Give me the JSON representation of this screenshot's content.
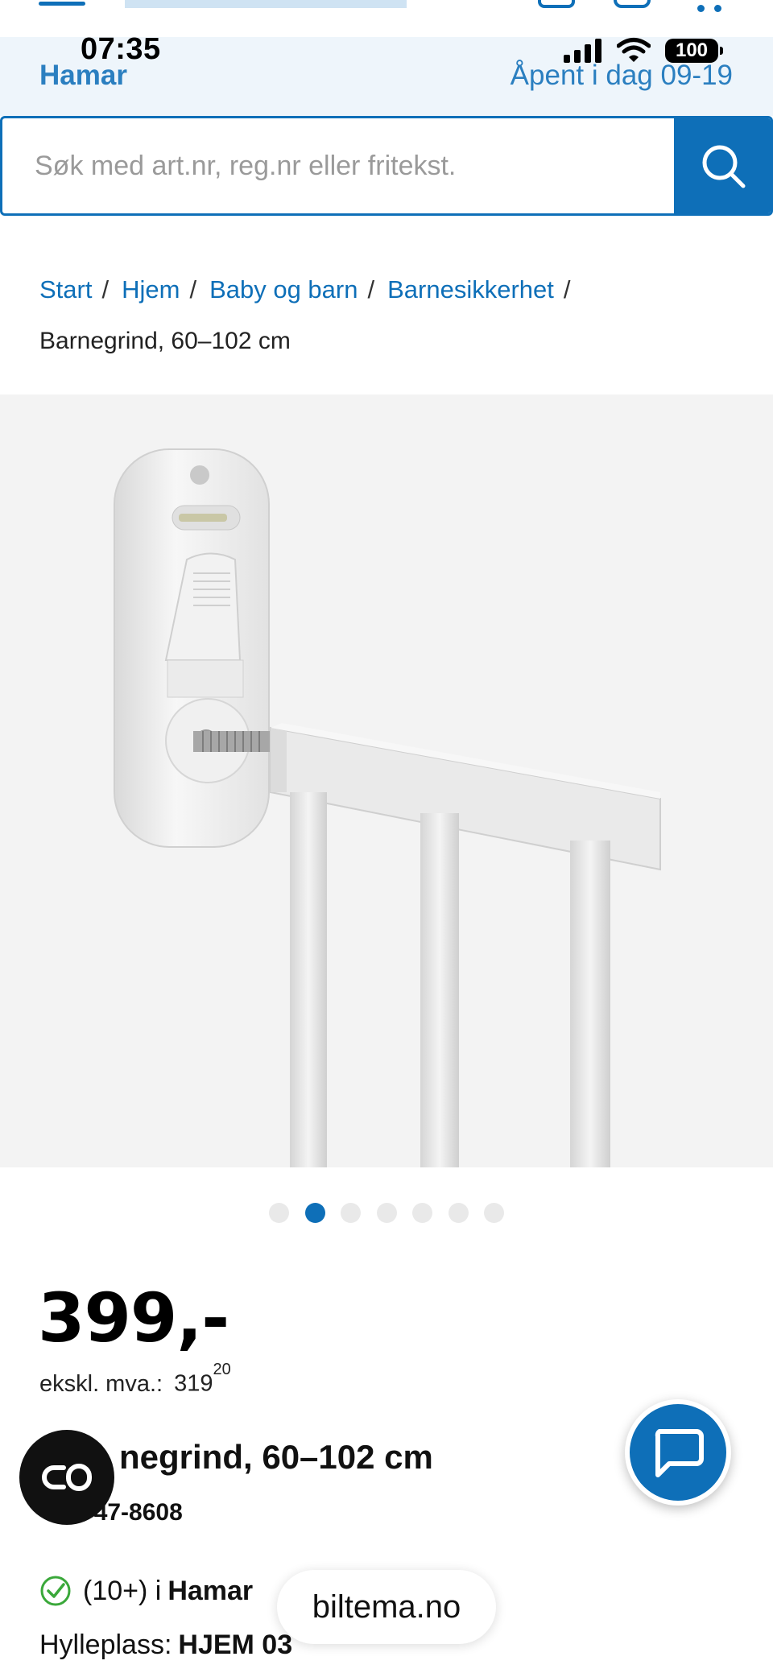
{
  "status_bar": {
    "time": "07:35",
    "battery": "100"
  },
  "store": {
    "name": "Hamar",
    "hours": "Åpent i dag 09-19"
  },
  "search": {
    "placeholder": "Søk med art.nr, reg.nr eller fritekst."
  },
  "breadcrumb": {
    "items": [
      "Start",
      "Hjem",
      "Baby og barn",
      "Barnesikkerhet"
    ],
    "separator": "/",
    "current": "Barnegrind, 60–102 cm"
  },
  "carousel": {
    "count": 7,
    "active_index": 1
  },
  "product": {
    "price": "399,-",
    "ex_vat_label": "ekskl. mva.:",
    "ex_vat_main": "319",
    "ex_vat_decimals": "20",
    "title": "negrind, 60–102 cm",
    "art_nr": "r. 47-8608",
    "stock_count": "(10+) i",
    "stock_store": "Hamar",
    "shelf_label": "Hylleplass:",
    "shelf_value": "HJEM 03"
  },
  "browser": {
    "url": "biltema.no"
  },
  "icons": {
    "search": "search-icon",
    "stock": "check-circle-icon",
    "chat": "chat-icon",
    "reader": "reader-mode-icon"
  },
  "colors": {
    "brand_blue": "#0e6fb8",
    "link_blue": "#2b7fc0",
    "stock_green": "#3aa83a"
  }
}
